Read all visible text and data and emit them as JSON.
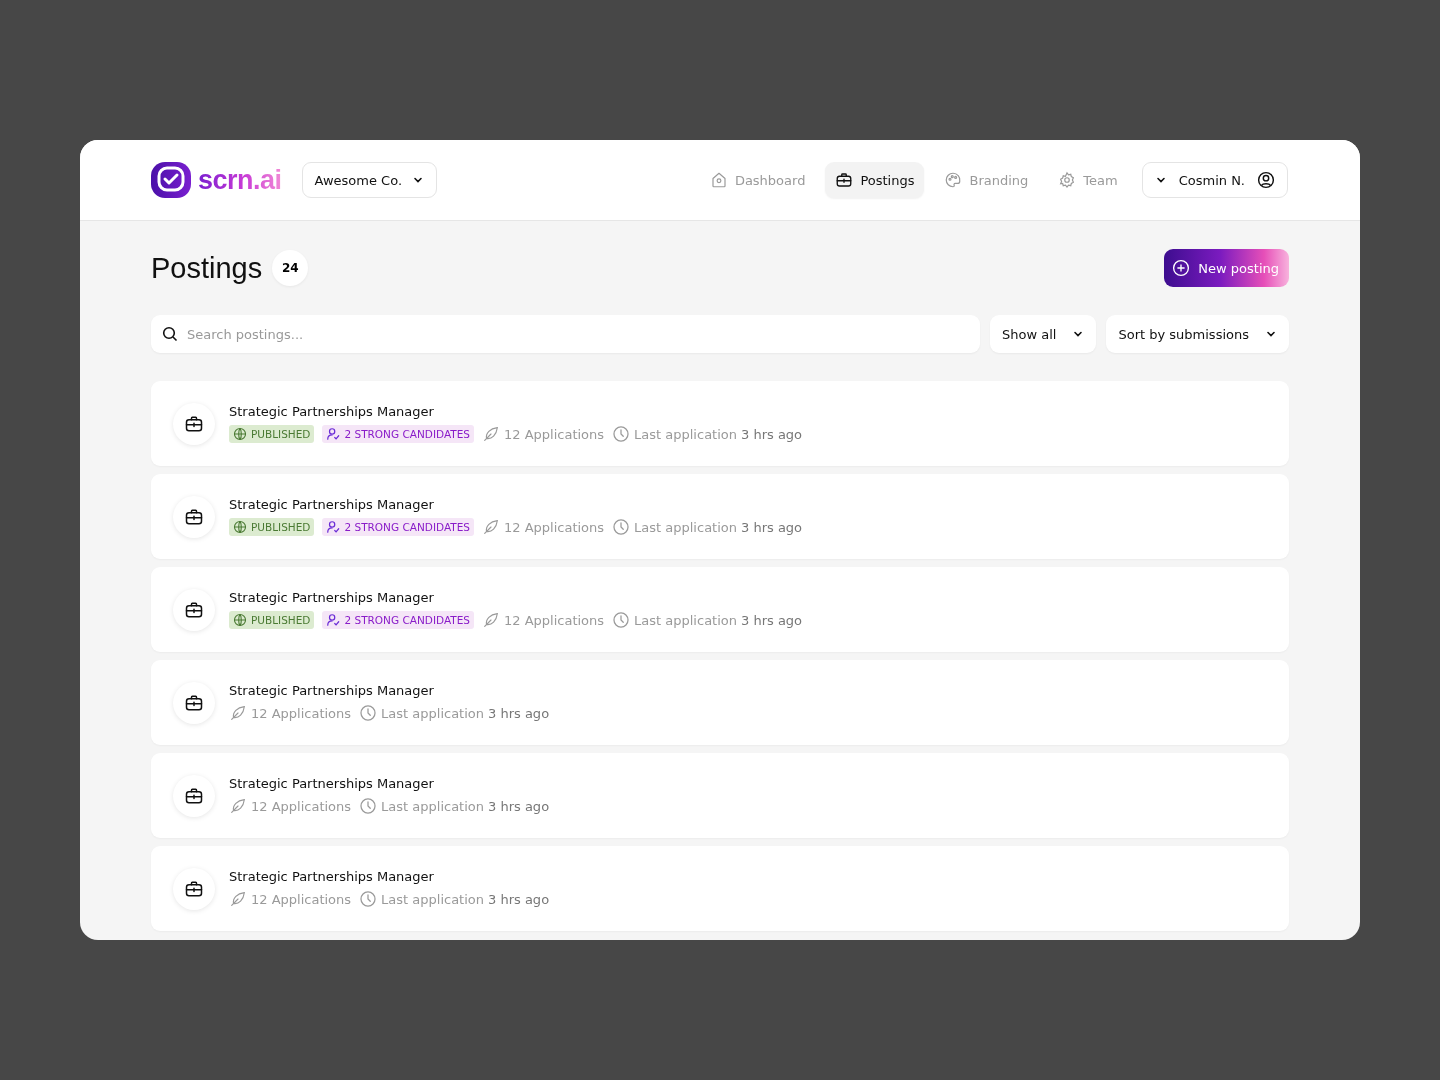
{
  "header": {
    "logo": "scrn.ai",
    "company": "Awesome Co.",
    "nav": [
      {
        "label": "Dashboard",
        "selected": false
      },
      {
        "label": "Postings",
        "selected": true
      },
      {
        "label": "Branding",
        "selected": false
      },
      {
        "label": "Team",
        "selected": false
      }
    ],
    "user": "Cosmin N."
  },
  "page": {
    "title": "Postings",
    "count": "24",
    "new_button": "New posting",
    "search": {
      "placeholder": "Search postings..."
    },
    "filter": "Show all",
    "sort": "Sort by submissions"
  },
  "postings": [
    {
      "title": "Strategic Partnerships Manager",
      "tags": [
        {
          "kind": "status",
          "label": "PUBLISHED"
        },
        {
          "kind": "candidates",
          "label": "2 STRONG CANDIDATES"
        }
      ],
      "applications": "12 Applications",
      "last_label": "Last application",
      "last_time": "3 hrs ago"
    },
    {
      "title": "Strategic Partnerships Manager",
      "tags": [
        {
          "kind": "status",
          "label": "PUBLISHED"
        },
        {
          "kind": "candidates",
          "label": "2 STRONG CANDIDATES"
        }
      ],
      "applications": "12 Applications",
      "last_label": "Last application",
      "last_time": "3 hrs ago"
    },
    {
      "title": "Strategic Partnerships Manager",
      "tags": [
        {
          "kind": "status",
          "label": "PUBLISHED"
        },
        {
          "kind": "candidates",
          "label": "2 STRONG CANDIDATES"
        }
      ],
      "applications": "12 Applications",
      "last_label": "Last application",
      "last_time": "3 hrs ago"
    },
    {
      "title": "Strategic Partnerships Manager",
      "applications": "12 Applications",
      "last_label": "Last application",
      "last_time": "3 hrs ago"
    },
    {
      "title": "Strategic Partnerships Manager",
      "applications": "12 Applications",
      "last_label": "Last application",
      "last_time": "3 hrs ago"
    },
    {
      "title": "Strategic Partnerships Manager",
      "applications": "12 Applications",
      "last_label": "Last application",
      "last_time": "3 hrs ago"
    }
  ]
}
